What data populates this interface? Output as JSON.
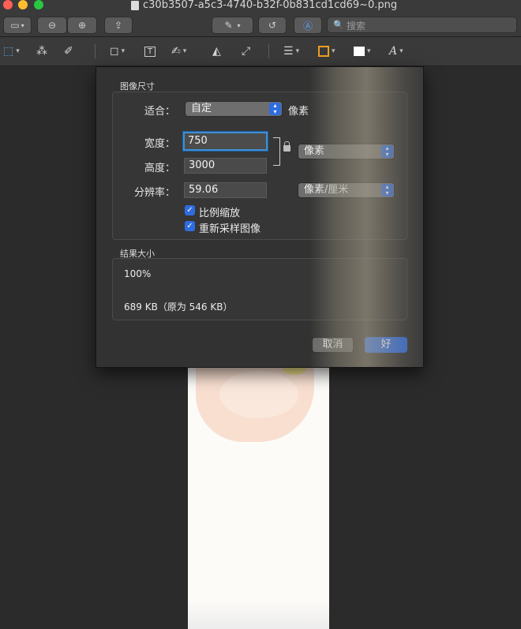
{
  "window": {
    "title": "c30b3507-a5c3-4740-b32f-0b831cd1cd69~0.png",
    "search_placeholder": "搜索"
  },
  "dialog": {
    "image_size_section": "图像尺寸",
    "fit_label": "适合：",
    "fit_value": "自定",
    "fit_unit": "像素",
    "width_label": "宽度：",
    "width_value": "750",
    "height_label": "高度：",
    "height_value": "3000",
    "size_unit": "像素",
    "resolution_label": "分辨率：",
    "resolution_value": "59.06",
    "resolution_unit": "像素/厘米",
    "scale_proportionally": "比例缩放",
    "scale_proportionally_checked": true,
    "resample_image": "重新采样图像",
    "resample_image_checked": true,
    "result_section": "结果大小",
    "result_percent": "100%",
    "result_filesize": "689 KB（原为 546 KB）",
    "cancel_button": "取消",
    "ok_button": "好"
  },
  "colors": {
    "accent": "#2f6ce0",
    "focus_ring": "#3d8fd6",
    "background": "#2b2b2b"
  }
}
